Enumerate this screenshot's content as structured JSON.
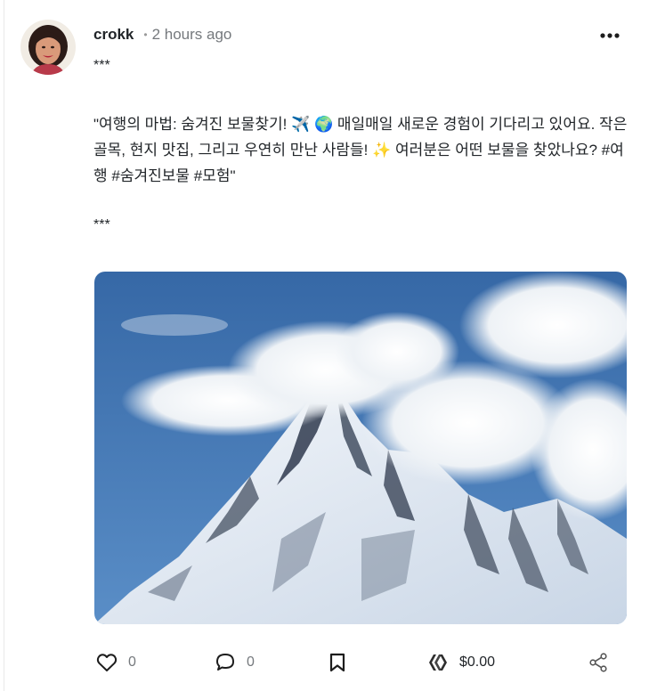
{
  "post": {
    "author": "crokk",
    "separator": "•",
    "time": "2 hours ago",
    "divider_top": "***",
    "paragraph": "\"여행의 마법: 숨겨진 보물찾기! ✈️ 🌍 매일매일 새로운 경험이 기다리고 있어요. 작은 골목, 현지 맛집, 그리고 우연히 만난 사람들! ✨ 여러분은 어떤 보물을 찾았나요? #여행 #숨겨진보물 #모험\"",
    "divider_bottom": "***"
  },
  "actions": {
    "like_count": "0",
    "comment_count": "0",
    "payout": "$0.00"
  },
  "icons": {
    "more": "more-dots-icon",
    "like": "heart-icon",
    "comment": "comment-bubble-icon",
    "bookmark": "bookmark-icon",
    "currency": "hive-logo-icon",
    "share": "share-icon"
  },
  "colors": {
    "text": "#212529",
    "muted": "#75797d",
    "sky": "#3f6fa8"
  }
}
